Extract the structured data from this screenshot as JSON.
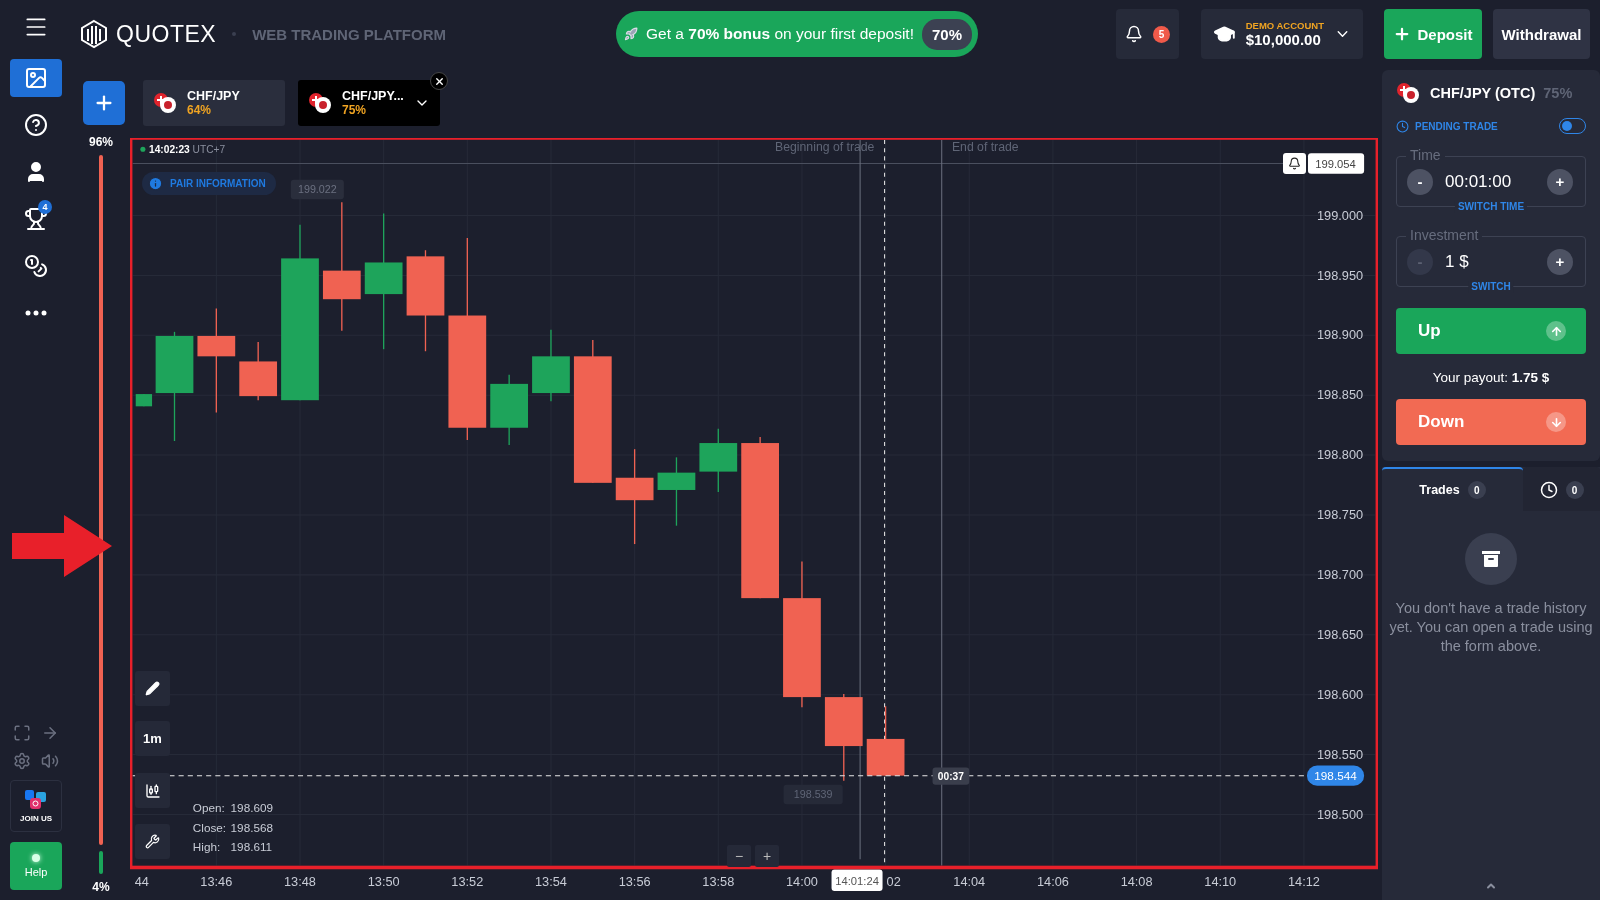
{
  "sidebar": {
    "nav": [
      {
        "kind": "chart",
        "selected": true
      },
      {
        "kind": "help",
        "selected": false
      },
      {
        "kind": "profile",
        "selected": false
      },
      {
        "kind": "trophy",
        "selected": false,
        "badge": "4"
      },
      {
        "kind": "coins",
        "selected": false
      },
      {
        "kind": "more",
        "selected": false
      }
    ],
    "join_label": "JOIN US",
    "help_label": "Help"
  },
  "header": {
    "brand": "QUOTEX",
    "subtitle": "WEB TRADING PLATFORM",
    "promo": {
      "text": "Get a **70% bonus** on your first deposit!",
      "badge": "70%"
    },
    "notifications": "5",
    "account": {
      "label": "DEMO ACCOUNT",
      "balance": "$10,000.00"
    },
    "deposit": "Deposit",
    "withdrawal": "Withdrawal"
  },
  "asset_tabs": [
    {
      "pair": "CHF/JPY",
      "payout": "64%",
      "selected": false
    },
    {
      "pair": "CHF/JPY...",
      "payout": "75%",
      "selected": true
    }
  ],
  "sentiment": {
    "up": "96%",
    "down": "4%",
    "level": 0.96
  },
  "chart": {
    "clock": "14:02:23",
    "timezone": "UTC+7",
    "pair_info": "PAIR INFORMATION",
    "trade_start": "Beginning of trade",
    "trade_end": "End of trade",
    "high_label": "199.022",
    "alert_price": "199.054",
    "low_label": "198.539",
    "countdown": "00:37",
    "current_price": "198.544",
    "cursor_time": "14:01:24",
    "timeframe": "1m",
    "y_labels": [
      "199.000",
      "198.950",
      "198.900",
      "198.850",
      "198.800",
      "198.750",
      "198.700",
      "198.650",
      "198.600",
      "198.550",
      "198.500"
    ],
    "x_labels": [
      "44",
      "13:46",
      "13:48",
      "13:50",
      "13:52",
      "13:54",
      "13:56",
      "13:58",
      "14:00",
      "02",
      "14:04",
      "14:06",
      "14:08",
      "14:10",
      "14:12"
    ],
    "ohlc": [
      {
        "label": "Open:",
        "value": "198.609"
      },
      {
        "label": "Close:",
        "value": "198.568"
      },
      {
        "label": "High:",
        "value": "198.611"
      }
    ],
    "zoom": [
      "−",
      "+"
    ]
  },
  "trade_panel": {
    "pair": "CHF/JPY (OTC)",
    "payout": "75%",
    "pending_label": "PENDING TRADE",
    "pending_on": false,
    "fields": [
      {
        "label": "Time",
        "value": "00:01:00",
        "switch": "SWITCH TIME",
        "minus": "-",
        "plus": "+",
        "minus_disabled": false
      },
      {
        "label": "Investment",
        "value": "1 $",
        "switch": "SWITCH",
        "minus": "-",
        "plus": "+",
        "minus_disabled": true
      }
    ],
    "up": "Up",
    "payout_text": "Your payout: **1.75 $**",
    "down": "Down"
  },
  "trades": {
    "tabs": [
      {
        "kind": "list",
        "label": "Trades",
        "count": "0",
        "selected": true
      },
      {
        "kind": "history",
        "count": "0",
        "selected": false
      }
    ],
    "empty_text": "You don't have a trade history yet. You can open a trade using the form above."
  }
}
